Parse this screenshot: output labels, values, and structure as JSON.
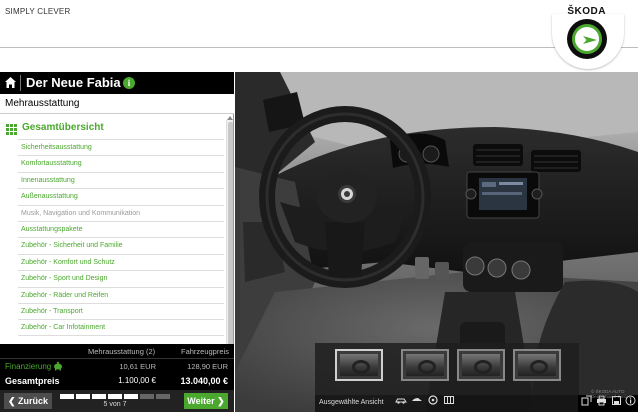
{
  "header": {
    "slogan": "SIMPLY CLEVER",
    "brand": "ŠKODA"
  },
  "panel": {
    "title": "Der Neue Fabia",
    "section": "Mehrausstattung",
    "overview_label": "Gesamtübersicht",
    "items": [
      {
        "label": "Sicherheitsausstattung",
        "disabled": false
      },
      {
        "label": "Komfortausstattung",
        "disabled": false
      },
      {
        "label": "Innenausstattung",
        "disabled": false
      },
      {
        "label": "Außenausstattung",
        "disabled": false
      },
      {
        "label": "Musik, Navigation und Kommunikation",
        "disabled": true
      },
      {
        "label": "Ausstattungspakete",
        "disabled": false
      },
      {
        "label": "Zubehör - Sicherheit und Familie",
        "disabled": false
      },
      {
        "label": "Zubehör - Komfort und Schutz",
        "disabled": false
      },
      {
        "label": "Zubehör - Sport und Design",
        "disabled": false
      },
      {
        "label": "Zubehör - Räder und Reifen",
        "disabled": false
      },
      {
        "label": "Zubehör - Transport",
        "disabled": false
      },
      {
        "label": "Zubehör - Car Infotainment",
        "disabled": false
      }
    ]
  },
  "prices": {
    "col1_header": "Mehrausstattung (2)",
    "col2_header": "Fahrzeugpreis",
    "financing_label": "Finanzierung",
    "financing_extras": "10,61 EUR",
    "financing_vehicle": "128,90 EUR",
    "total_label": "Gesamtpreis",
    "total_extras": "1.100,00 €",
    "total_vehicle": "13.040,00 €"
  },
  "navigation": {
    "back_label": "❮ Zurück",
    "next_label": "Weiter ❯",
    "step_text": "5 von 7",
    "current_step": 5,
    "total_steps": 7
  },
  "view": {
    "selected_view_label": "Ausgewählte Ansicht",
    "thumbnail_count": 4,
    "active_thumbnail": 1,
    "watermark": "© ŠKODA AUTO Deutschland GmbH"
  },
  "colors": {
    "accent": "#4ba82e",
    "panel_black": "#000000"
  }
}
